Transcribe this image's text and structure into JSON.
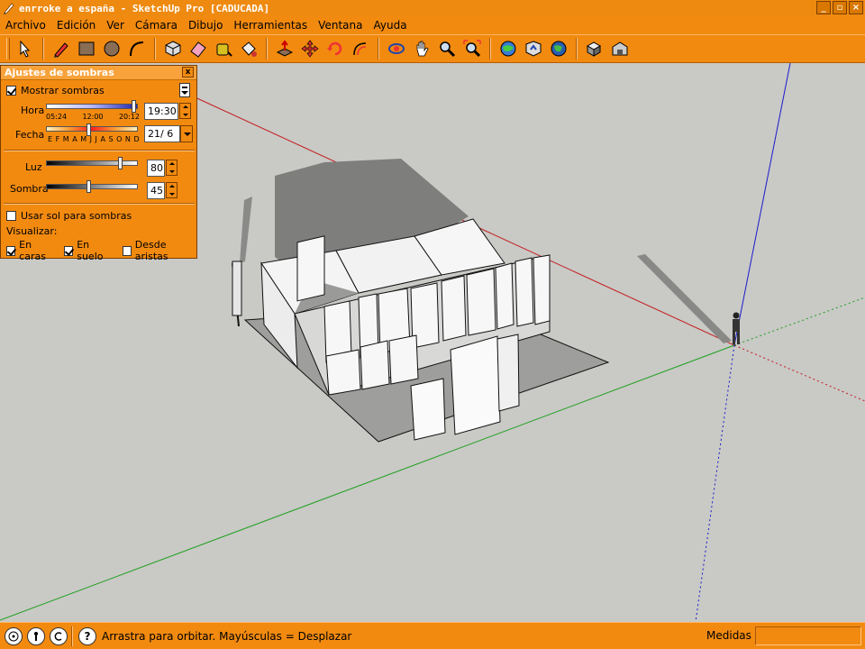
{
  "window": {
    "title": "enrroke a españa - SketchUp Pro [CADUCADA]",
    "min_label": "_",
    "max_label": "▫",
    "close_label": "×"
  },
  "menu": [
    "Archivo",
    "Edición",
    "Ver",
    "Cámara",
    "Dibujo",
    "Herramientas",
    "Ventana",
    "Ayuda"
  ],
  "toolbar": {
    "buttons": [
      "select-icon",
      "pencil-icon",
      "rectangle-icon",
      "circle-icon",
      "arc-icon",
      "make-component-icon",
      "eraser-icon",
      "tape-measure-icon",
      "paint-bucket-icon",
      "push-pull-icon",
      "move-icon",
      "rotate-icon",
      "offset-icon",
      "orbit-icon",
      "pan-icon",
      "zoom-icon",
      "zoom-extents-icon",
      "get-models-icon",
      "share-model-icon",
      "google-earth-icon",
      "components-icon",
      "warehouse-icon"
    ]
  },
  "shadow_panel": {
    "title": "Ajustes de sombras",
    "close_label": "x",
    "show_shadows_label": "Mostrar sombras",
    "show_shadows_checked": true,
    "time_label": "Hora",
    "time_ticks": [
      "05:24",
      "12:00",
      "20:12"
    ],
    "time_value": "19:30",
    "time_slider_fraction": 0.95,
    "date_label": "Fecha",
    "date_ticks": "E F M A M J J A S O N D",
    "date_value": "21/ 6",
    "date_slider_fraction": 0.45,
    "light_label": "Luz",
    "light_value": "80",
    "light_fraction": 0.8,
    "dark_label": "Sombra",
    "dark_value": "45",
    "dark_fraction": 0.45,
    "use_sun_label": "Usar sol para sombras",
    "use_sun_checked": false,
    "display_label": "Visualizar:",
    "on_faces_label": "En caras",
    "on_faces_checked": true,
    "on_ground_label": "En suelo",
    "on_ground_checked": true,
    "from_edges_label": "Desde aristas",
    "from_edges_checked": false
  },
  "status": {
    "hint": "Arrastra para orbitar. Mayúsculas = Desplazar",
    "measure_label": "Medidas",
    "measure_value": "",
    "icons": [
      "geo-location-icon",
      "credits-icon",
      "copyright-icon",
      "help-icon"
    ]
  },
  "colors": {
    "ui_orange": "#f28a10",
    "viewport_bg": "#c9c9c6",
    "axis_red": "#c41c1c",
    "axis_green": "#1ea01e",
    "axis_blue": "#1a1acb"
  }
}
